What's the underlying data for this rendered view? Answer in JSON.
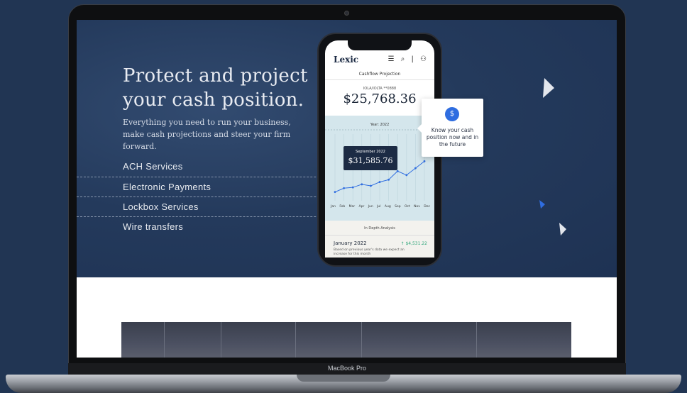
{
  "hero": {
    "headline": "Protect and project your cash position.",
    "subheadline": "Everything you need to run your business, make cash projections and steer your firm forward.",
    "services": [
      "ACH Services",
      "Electronic Payments",
      "Lockbox Services",
      "Wire transfers"
    ]
  },
  "phone": {
    "logo": "Lexic",
    "header_icons": "☰ ⌕ | ⚇",
    "title": "Cashflow Projection",
    "account": "IOLA/IOLTA **0888",
    "balance": "$25,768.36",
    "chart": {
      "year_label": "Year: 2022",
      "tooltip_month": "September 2022",
      "tooltip_value": "$31,585.76"
    },
    "in_depth": {
      "title": "In Depth Analysis",
      "month": "January 2022",
      "amount": "↑ $4,531.22",
      "description": "Based on previous year's data we expect an increase for this month"
    }
  },
  "callout": {
    "icon": "$",
    "text": "Know your cash position now and in the future"
  },
  "laptop": {
    "model_label": "MacBook Pro"
  },
  "chart_data": {
    "type": "line",
    "categories": [
      "Jan",
      "Feb",
      "Mar",
      "Apr",
      "Jun",
      "Jul",
      "Aug",
      "Sep",
      "Oct",
      "Nov",
      "Dec"
    ],
    "series": [
      {
        "values": [
          18000,
          20500,
          21000,
          23000,
          22000,
          24500,
          26000,
          31585.76,
          29000,
          33500,
          38000
        ]
      }
    ],
    "title": "Year: 2022",
    "xlabel": "",
    "ylabel": ""
  },
  "colors": {
    "hero_bg": "#243a5c",
    "accent_blue": "#2f6de0",
    "chart_bg": "#d4e6ec",
    "positive": "#2fa67a"
  }
}
